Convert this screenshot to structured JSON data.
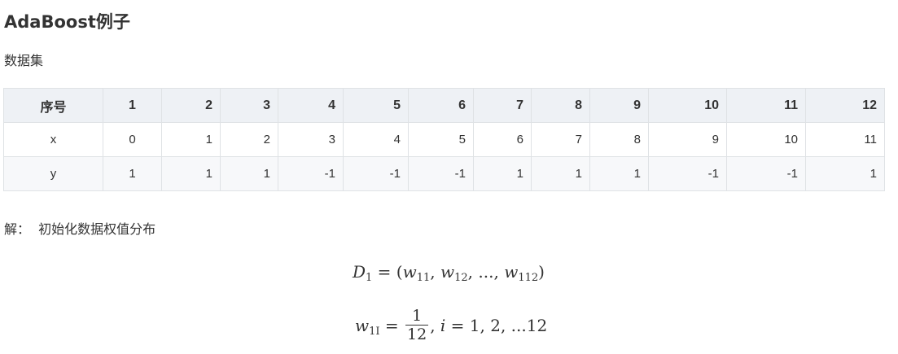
{
  "heading": "AdaBoost例子",
  "dataset_label": "数据集",
  "table": {
    "header": [
      "序号",
      "1",
      "2",
      "3",
      "4",
      "5",
      "6",
      "7",
      "8",
      "9",
      "10",
      "11",
      "12"
    ],
    "rows": [
      [
        "x",
        "0",
        "1",
        "2",
        "3",
        "4",
        "5",
        "6",
        "7",
        "8",
        "9",
        "10",
        "11"
      ],
      [
        "y",
        "1",
        "1",
        "1",
        "-1",
        "-1",
        "-1",
        "1",
        "1",
        "1",
        "-1",
        "-1",
        "1"
      ]
    ]
  },
  "solution_text": "解：  初始化数据权值分布",
  "equations": {
    "eq1": {
      "lhs": "D",
      "lhs_sub": "1",
      "eq": " = (",
      "w1": "w",
      "w1_sub": "11",
      "comma1": ", ",
      "w2": "w",
      "w2_sub": "12",
      "mid": ", ..., ",
      "w3": "w",
      "w3_sub": "112",
      "close": ")"
    },
    "eq2": {
      "lhs": "w",
      "lhs_sub": "1I",
      "eq": " = ",
      "num": "1",
      "den": "12",
      "tail_comma": ", ",
      "i": "i",
      "tail": " = 1, 2, ...12"
    }
  }
}
